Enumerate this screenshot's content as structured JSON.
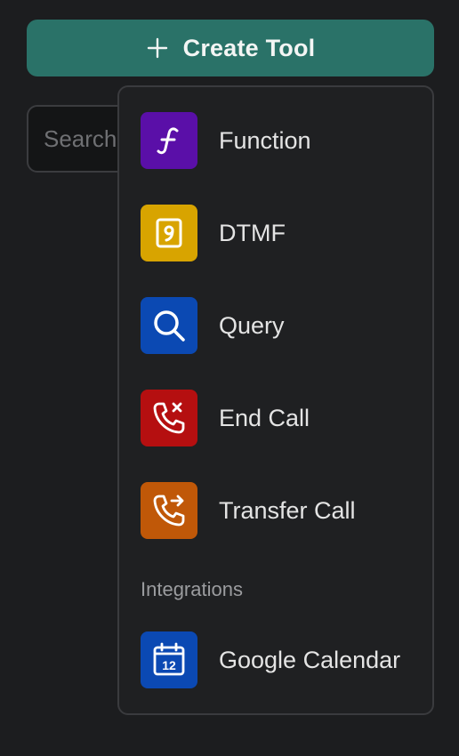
{
  "create_button": {
    "label": "Create Tool",
    "icon": "plus-icon"
  },
  "search": {
    "placeholder": "Search",
    "value": ""
  },
  "menu": {
    "items": [
      {
        "label": "Function",
        "icon": "function-icon",
        "color": "#5a0fa8"
      },
      {
        "label": "DTMF",
        "icon": "dialpad-nine-icon",
        "color": "#d8a400"
      },
      {
        "label": "Query",
        "icon": "search-icon",
        "color": "#0b49b3"
      },
      {
        "label": "End Call",
        "icon": "phone-end-icon",
        "color": "#b50f10"
      },
      {
        "label": "Transfer Call",
        "icon": "phone-transfer-icon",
        "color": "#c05808"
      }
    ],
    "section_label": "Integrations",
    "integrations": [
      {
        "label": "Google Calendar",
        "icon": "calendar-12-icon",
        "color": "#0b49b3"
      }
    ]
  }
}
